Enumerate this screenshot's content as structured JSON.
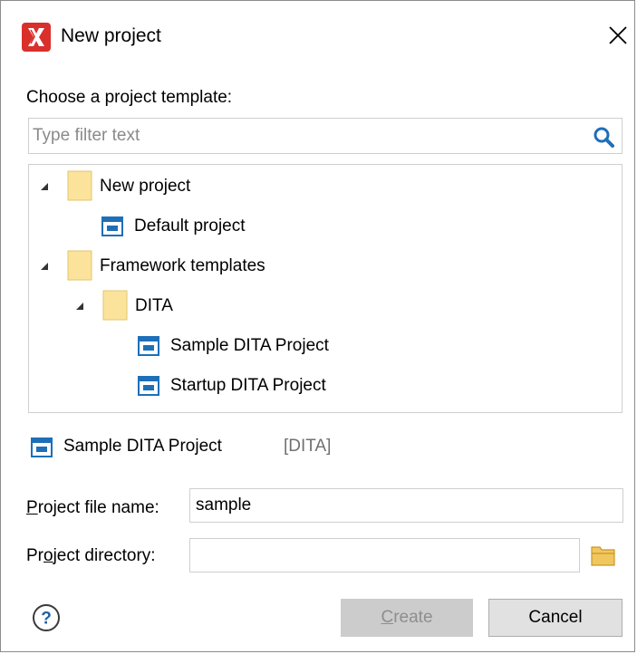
{
  "dialog": {
    "title": "New project",
    "prompt": "Choose a project template:"
  },
  "filter": {
    "placeholder": "Type filter text",
    "value": ""
  },
  "tree": {
    "items": [
      {
        "label": "New project",
        "type": "folder",
        "expanded": true,
        "level": 0
      },
      {
        "label": "Default project",
        "type": "project",
        "level": 1
      },
      {
        "label": "Framework templates",
        "type": "folder",
        "expanded": true,
        "level": 0
      },
      {
        "label": "DITA",
        "type": "folder",
        "expanded": true,
        "level": 1
      },
      {
        "label": "Sample DITA Project",
        "type": "project",
        "level": 2
      },
      {
        "label": "Startup DITA Project",
        "type": "project",
        "level": 2
      }
    ]
  },
  "selection": {
    "name": "Sample DITA Project",
    "tag": "[DITA]"
  },
  "form": {
    "file_name_label_mnemonic": "P",
    "file_name_label_rest": "roject file name:",
    "file_name_value": "sample",
    "directory_label_pre": "Pr",
    "directory_label_mnemonic": "o",
    "directory_label_rest": "ject directory:",
    "directory_value": ""
  },
  "buttons": {
    "create_mnemonic": "C",
    "create_rest": "reate",
    "cancel": "Cancel"
  },
  "colors": {
    "app_icon_red": "#d9302c",
    "folder_yellow": "#fbe39c",
    "project_blue": "#1e6fb8",
    "search_blue": "#1e6fb8",
    "create_disabled_bg": "#cccccc",
    "cancel_bg": "#e1e1e1"
  },
  "icons": {
    "app": "oxygen-app-icon",
    "close": "close-icon",
    "search": "search-icon",
    "folder": "folder-icon",
    "project": "project-icon",
    "browse": "folder-open-icon",
    "help": "help-icon"
  }
}
